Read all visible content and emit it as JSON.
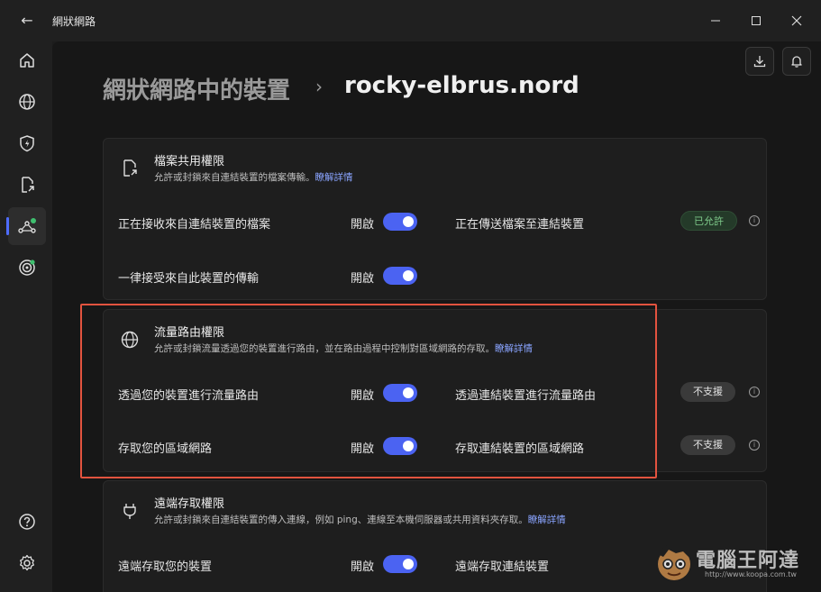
{
  "window": {
    "title": "網狀網路",
    "back_glyph": "←",
    "minimize_glyph": "—",
    "maximize_glyph": "☐",
    "close_glyph": "✕"
  },
  "sidebar": {
    "items": [
      {
        "icon": "home-icon",
        "active": false
      },
      {
        "icon": "globe-icon",
        "active": false
      },
      {
        "icon": "shield-bolt-icon",
        "active": false
      },
      {
        "icon": "file-share-icon",
        "active": false
      },
      {
        "icon": "meshnet-icon",
        "active": true
      },
      {
        "icon": "target-icon",
        "active": false
      },
      {
        "icon": "help-icon",
        "active": false
      },
      {
        "icon": "settings-icon",
        "active": false
      }
    ]
  },
  "header": {
    "breadcrumb_root": "網狀網路中的裝置",
    "separator": "›",
    "current": "rocky-elbrus.nord"
  },
  "sections": {
    "file_sharing": {
      "title": "檔案共用權限",
      "description": "允許或封鎖來自連結裝置的檔案傳輸。",
      "learn_more": "瞭解詳情",
      "receive_label": "正在接收來自連結裝置的檔案",
      "receive_state": "開啟",
      "send_label": "正在傳送檔案至連結裝置",
      "send_badge": "已允許",
      "auto_accept_label": "一律接受來自此裝置的傳輸",
      "auto_accept_state": "開啟"
    },
    "routing": {
      "title": "流量路由權限",
      "description": "允許或封鎖流量透過您的裝置進行路由，並在路由過程中控制對區域網路的存取。",
      "learn_more": "瞭解詳情",
      "route_label": "透過您的裝置進行流量路由",
      "route_state": "開啟",
      "route_peer_label": "透過連結裝置進行流量路由",
      "route_peer_badge": "不支援",
      "lan_label": "存取您的區域網路",
      "lan_state": "開啟",
      "lan_peer_label": "存取連結裝置的區域網路",
      "lan_peer_badge": "不支援"
    },
    "remote": {
      "title": "遠端存取權限",
      "description": "允許或封鎖來自連結裝置的傳入連線，例如 ping、連線至本機伺服器或共用資料夾存取。",
      "learn_more": "瞭解詳情",
      "remote_label": "遠端存取您的裝置",
      "remote_state": "開啟",
      "remote_peer_label": "遠端存取連結裝置"
    }
  },
  "watermark": {
    "text": "電腦王阿達",
    "url": "http://www.koopa.com.tw"
  },
  "colors": {
    "accent": "#4b63f2",
    "highlight_box": "#e2533f",
    "link": "#8aa4ff",
    "allowed_text": "#7ec98a",
    "status_dot": "#3fbf6f"
  }
}
